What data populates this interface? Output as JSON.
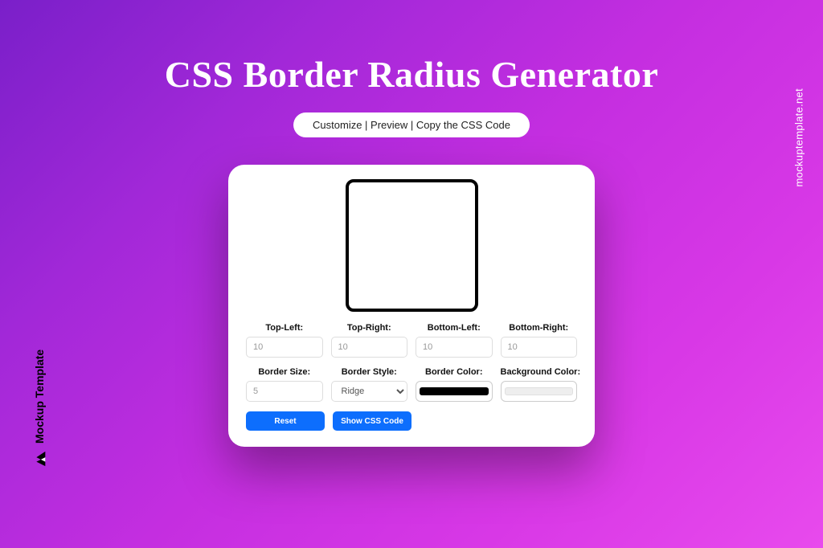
{
  "title": "CSS Border Radius Generator",
  "subtitle": "Customize | Preview | Copy the CSS Code",
  "watermark_left": "Mockup Template",
  "watermark_right": "mockuptemplate.net",
  "controls": {
    "top_left": {
      "label": "Top-Left:",
      "value": "10"
    },
    "top_right": {
      "label": "Top-Right:",
      "value": "10"
    },
    "bottom_left": {
      "label": "Bottom-Left:",
      "value": "10"
    },
    "bottom_right": {
      "label": "Bottom-Right:",
      "value": "10"
    },
    "border_size": {
      "label": "Border Size:",
      "value": "5"
    },
    "border_style": {
      "label": "Border Style:",
      "selected": "Ridge"
    },
    "border_color": {
      "label": "Border Color:"
    },
    "background_color": {
      "label": "Background Color:"
    }
  },
  "buttons": {
    "reset": "Reset",
    "show_code": "Show CSS Code"
  }
}
